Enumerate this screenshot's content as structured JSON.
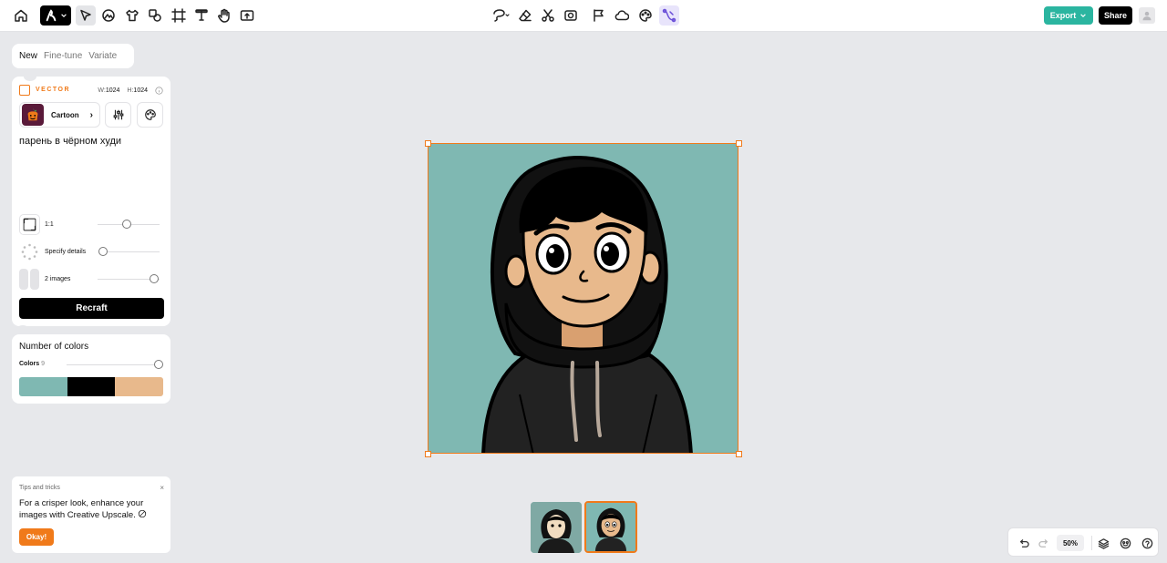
{
  "toolbar": {
    "export_label": "Export",
    "share_label": "Share"
  },
  "mode_tabs": [
    "New",
    "Fine-tune",
    "Variate"
  ],
  "generate_panel": {
    "type_label": "VECTOR",
    "width_label": "W:",
    "width_value": "1024",
    "height_label": "H:",
    "height_value": "1024",
    "style_name": "Cartoon",
    "prompt": "парень в чёрном худи",
    "aspect_label": "1:1",
    "details_label": "Specify details",
    "images_label": "2 images",
    "recraft_label": "Recraft"
  },
  "colors_panel": {
    "title": "Number of colors",
    "colors_label": "Colors",
    "colors_count": "9",
    "swatches": [
      "#7fb8b2",
      "#000000",
      "#e8b98c"
    ]
  },
  "tips": {
    "title": "Tips and tricks",
    "close": "×",
    "body": "For a crisper look, enhance your images with Creative Upscale.",
    "okay_label": "Okay!"
  },
  "zoom": {
    "value": "50%"
  },
  "colors": {
    "accent": "#f07a1a",
    "export": "#2bb5a0",
    "canvas_bg": "#7fb8b2",
    "skin": "#e8b98c"
  }
}
